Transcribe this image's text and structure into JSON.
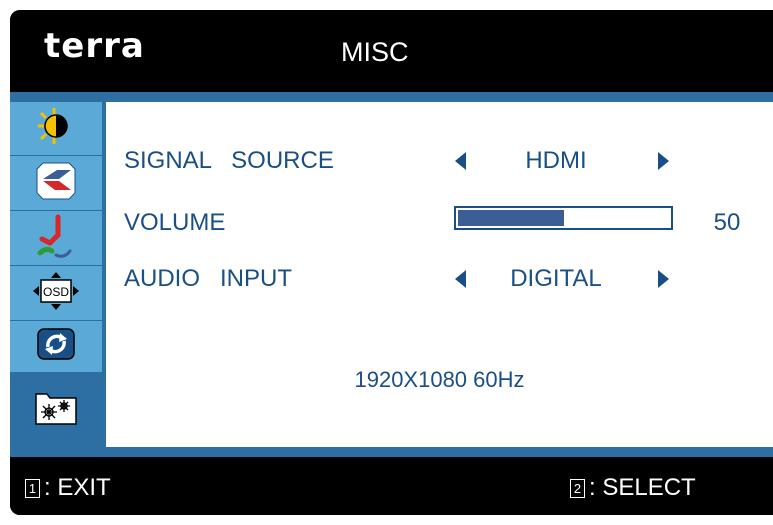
{
  "header": {
    "brand": "terra",
    "title": "MISC"
  },
  "sidebar": {
    "items": [
      {
        "name": "brightness-contrast-icon",
        "active": false
      },
      {
        "name": "image-position-icon",
        "active": false
      },
      {
        "name": "color-adjust-icon",
        "active": false
      },
      {
        "name": "osd-position-icon",
        "active": false
      },
      {
        "name": "reset-icon",
        "active": false
      },
      {
        "name": "misc-settings-icon",
        "active": true
      }
    ]
  },
  "main": {
    "signal_source": {
      "label": "SIGNAL   SOURCE",
      "value": "HDMI"
    },
    "volume": {
      "label": "VOLUME",
      "value": "50",
      "level": 0.5
    },
    "audio_input": {
      "label": "AUDIO   INPUT",
      "value": "DIGITAL"
    },
    "resolution": "1920X1080 60Hz"
  },
  "footer": {
    "exit_key": "1",
    "exit_label": ": EXIT",
    "select_key": "2",
    "select_label": ": SELECT"
  },
  "colors": {
    "accent": "#2d6fa3",
    "sidebar_item": "#5aa9d6",
    "text": "#1a4f86",
    "bar_fill": "#3c5e96"
  }
}
